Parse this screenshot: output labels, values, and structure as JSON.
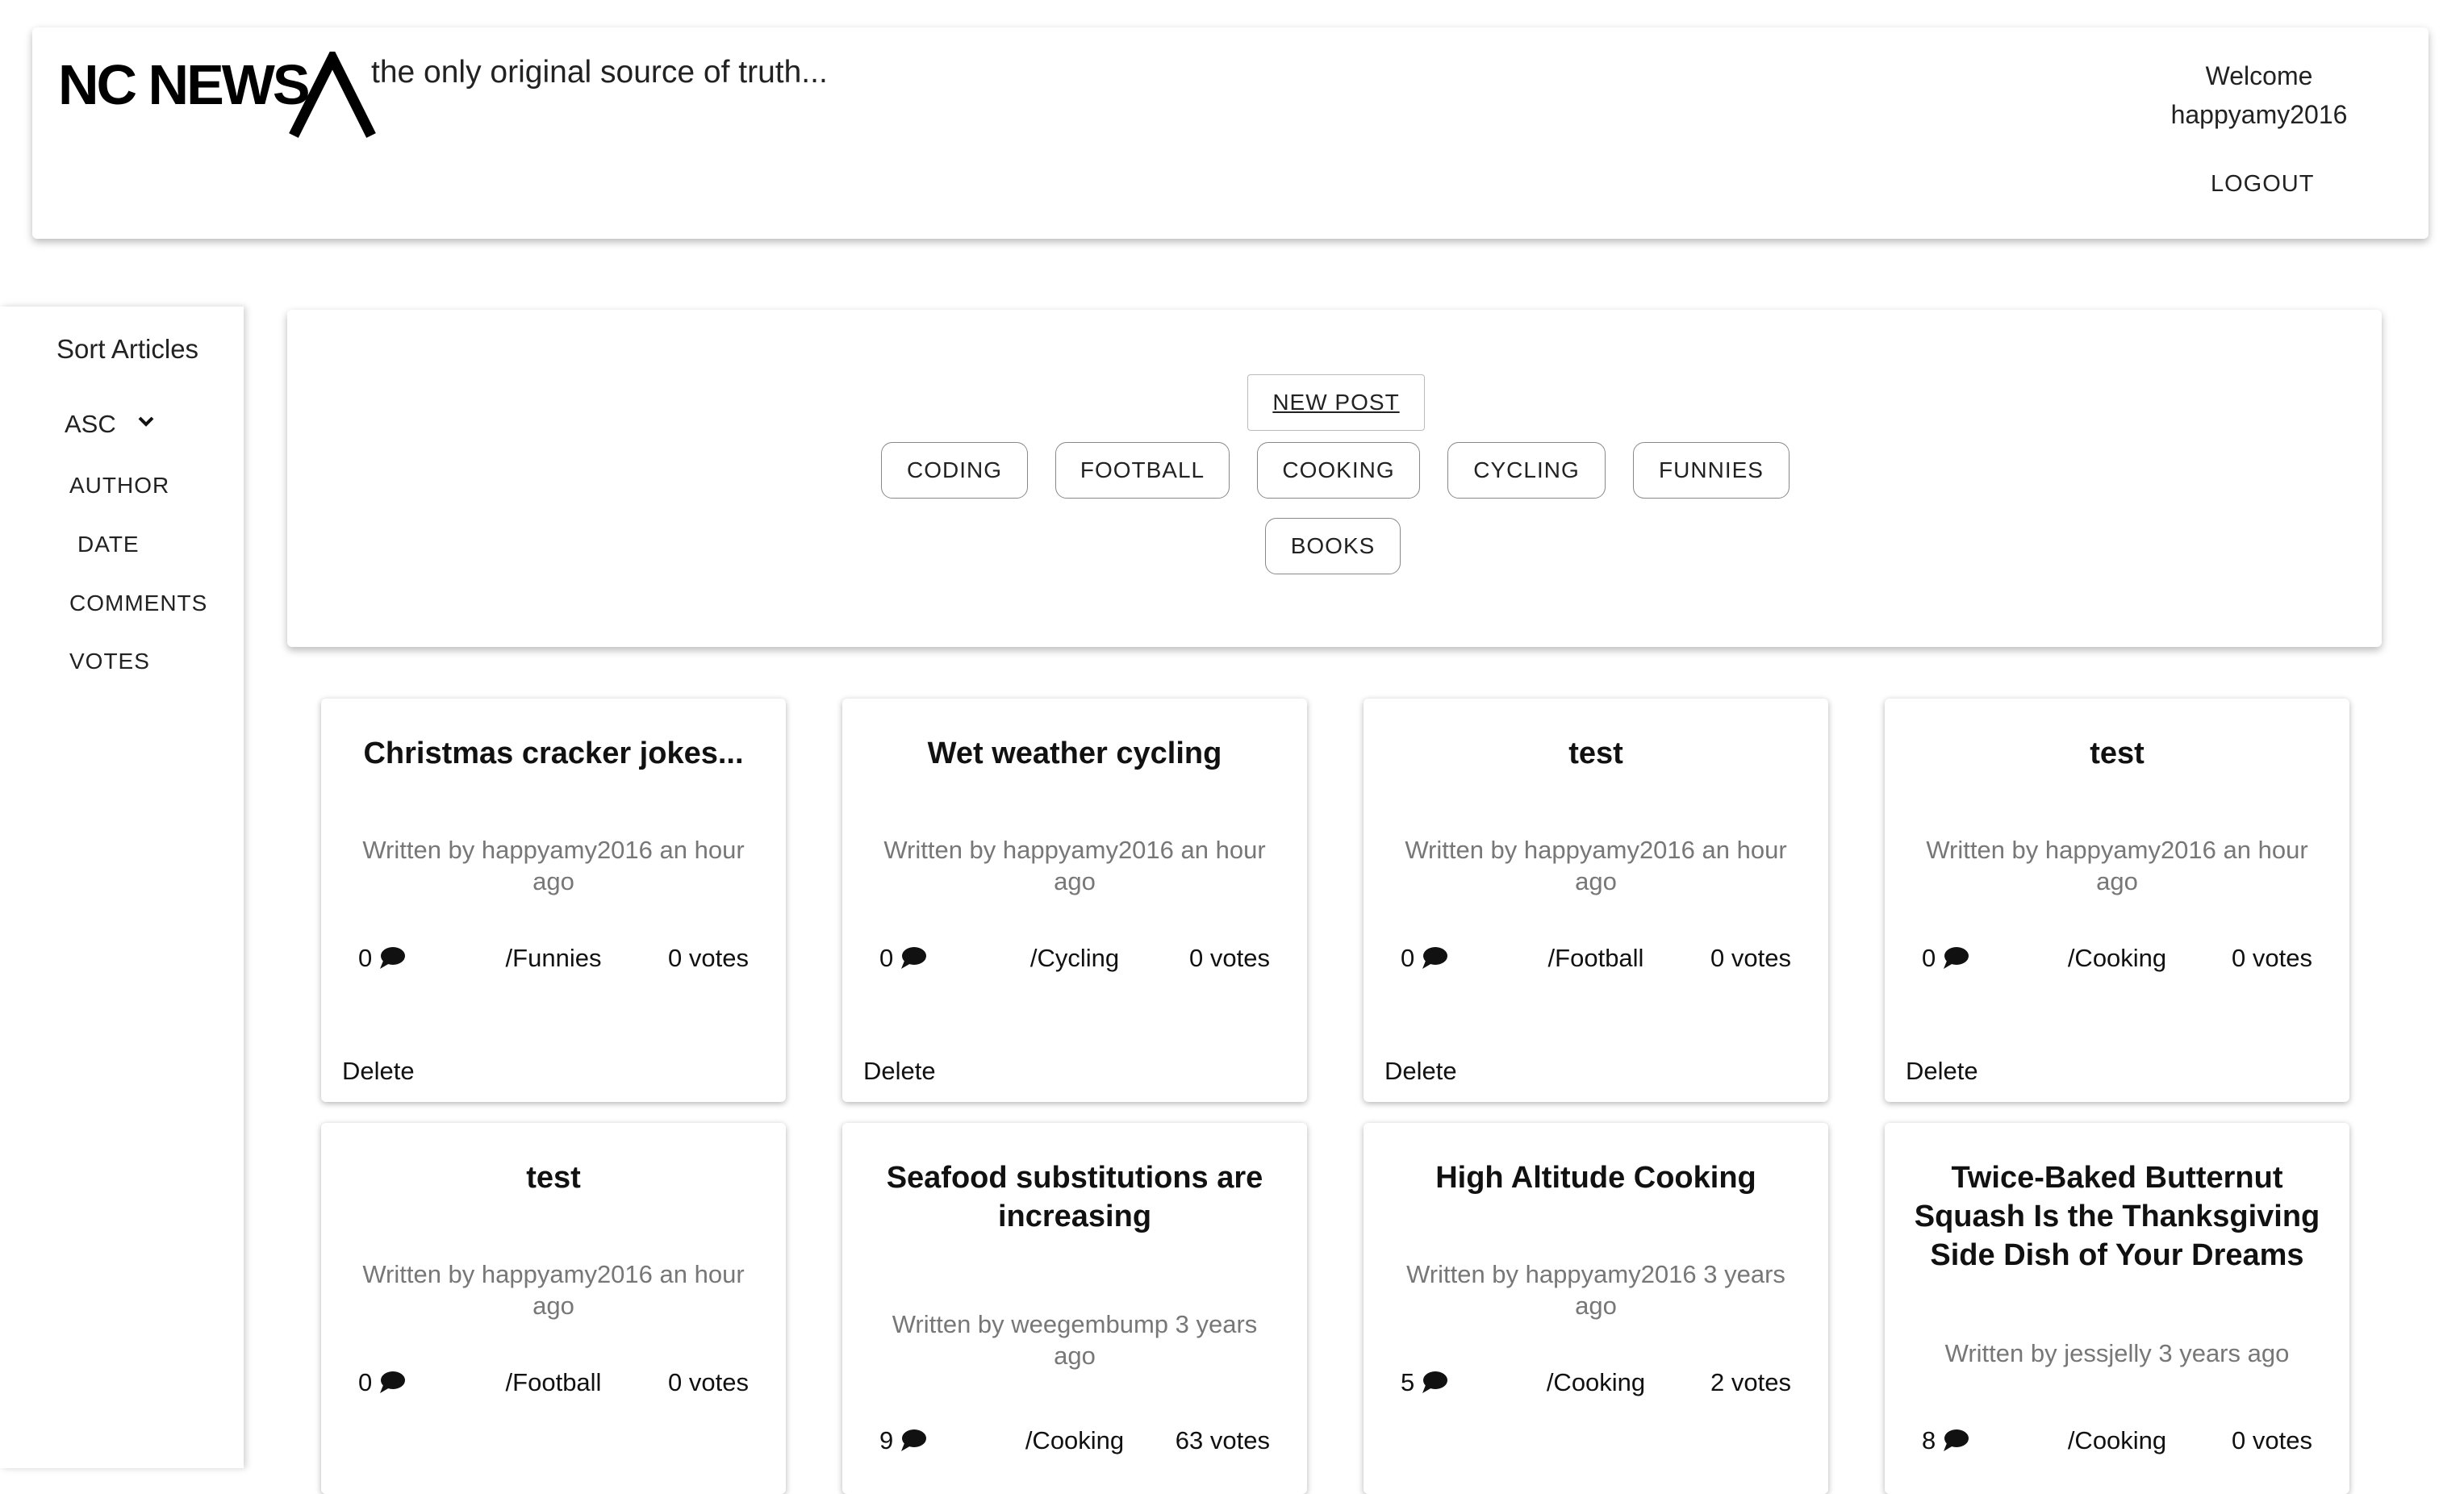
{
  "header": {
    "logo": "NC NEWS",
    "tagline": "the only original source of truth...",
    "welcome": "Welcome",
    "username": "happyamy2016",
    "logout": "LOGOUT"
  },
  "sidebar": {
    "title": "Sort Articles",
    "order": "ASC",
    "options": [
      "AUTHOR",
      "DATE",
      "COMMENTS",
      "VOTES"
    ]
  },
  "topics": {
    "new_post": "NEW POST",
    "items": [
      "CODING",
      "FOOTBALL",
      "COOKING",
      "CYCLING",
      "FUNNIES",
      "BOOKS"
    ]
  },
  "articles": [
    {
      "title": "Christmas cracker jokes...",
      "meta": "Written by happyamy2016 an hour ago",
      "comments": "0",
      "topic": "/Funnies",
      "votes": "0 votes",
      "delete": "Delete"
    },
    {
      "title": "Wet weather cycling",
      "meta": "Written by happyamy2016 an hour ago",
      "comments": "0",
      "topic": "/Cycling",
      "votes": "0 votes",
      "delete": "Delete"
    },
    {
      "title": "test",
      "meta": "Written by happyamy2016 an hour ago",
      "comments": "0",
      "topic": "/Football",
      "votes": "0 votes",
      "delete": "Delete"
    },
    {
      "title": "test",
      "meta": "Written by happyamy2016 an hour ago",
      "comments": "0",
      "topic": "/Cooking",
      "votes": "0 votes",
      "delete": "Delete"
    },
    {
      "title": "test",
      "meta": "Written by happyamy2016 an hour ago",
      "comments": "0",
      "topic": "/Football",
      "votes": "0 votes"
    },
    {
      "title": "Seafood substitutions are increasing",
      "meta": "Written by weegembump 3 years ago",
      "comments": "9",
      "topic": "/Cooking",
      "votes": "63 votes"
    },
    {
      "title": "High Altitude Cooking",
      "meta": "Written by happyamy2016 3 years ago",
      "comments": "5",
      "topic": "/Cooking",
      "votes": "2 votes"
    },
    {
      "title": "Twice-Baked Butternut Squash Is the Thanksgiving Side Dish of Your Dreams",
      "meta": "Written by jessjelly 3 years ago",
      "comments": "8",
      "topic": "/Cooking",
      "votes": "0 votes"
    }
  ],
  "icons": {
    "comment": "speech-bubble-icon",
    "chevron": "chevron-down-icon",
    "logo_mark": "caret-logo-icon"
  }
}
